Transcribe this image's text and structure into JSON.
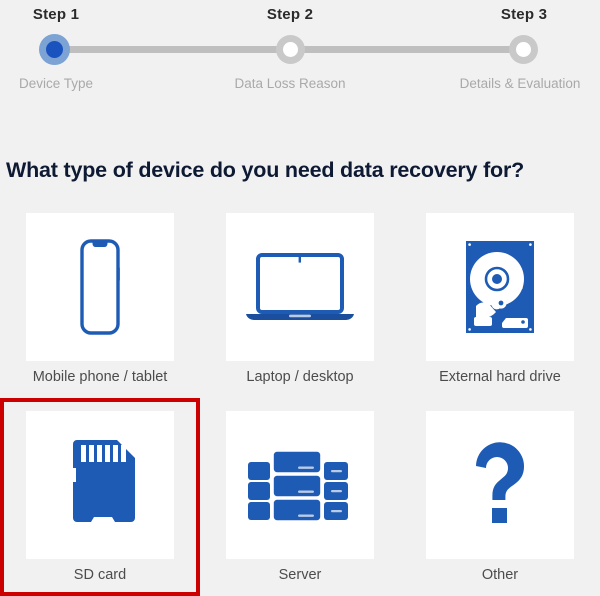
{
  "theme": {
    "page_background": "#f1f1f1",
    "tile_background": "#ffffff",
    "accent_blue": "#1e5bb5",
    "active_step_ring": "#7ca3d4",
    "active_step_dot": "#1a53bd",
    "pending_step_ring": "#c9c9c9",
    "track_gray": "#bfbfbf",
    "heading_color": "#0e1a33",
    "label_color": "#4c4c4c",
    "muted_label_color": "#a9a9a9",
    "selection_border": "#cc0000"
  },
  "stepper": {
    "steps": [
      {
        "title": "Step 1",
        "label": "Device Type",
        "state": "active"
      },
      {
        "title": "Step 2",
        "label": "Data Loss Reason",
        "state": "pending"
      },
      {
        "title": "Step 3",
        "label": "Details & Evaluation",
        "state": "pending"
      }
    ]
  },
  "main": {
    "heading": "What type of device do you need data recovery for?",
    "options": [
      {
        "label": "Mobile phone / tablet",
        "icon": "smartphone-icon",
        "selected": false
      },
      {
        "label": "Laptop / desktop",
        "icon": "laptop-icon",
        "selected": false
      },
      {
        "label": "External hard drive",
        "icon": "hard-drive-icon",
        "selected": false
      },
      {
        "label": "SD card",
        "icon": "sd-card-icon",
        "selected": true
      },
      {
        "label": "Server",
        "icon": "server-icon",
        "selected": false
      },
      {
        "label": "Other",
        "icon": "question-mark-icon",
        "selected": false
      }
    ]
  }
}
